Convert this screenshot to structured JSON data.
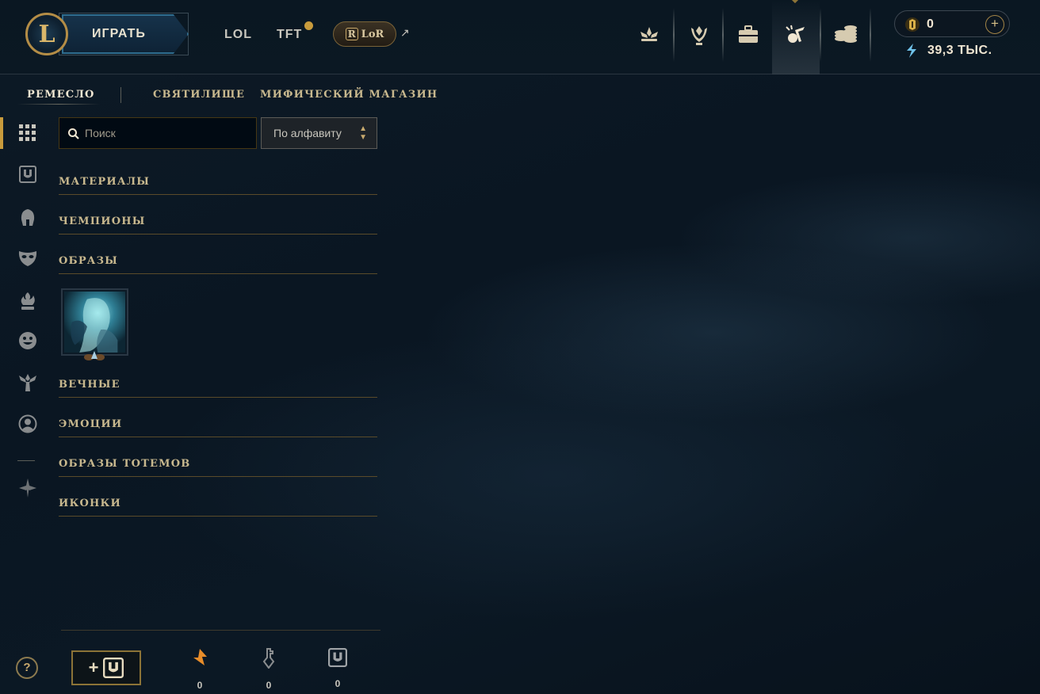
{
  "header": {
    "play_label": "ИГРАТЬ",
    "logo_letter": "L",
    "nav": [
      {
        "label": "LOL"
      },
      {
        "label": "TFT"
      }
    ],
    "lor_label": "LoR",
    "lor_letter": "R",
    "external_arrow": "↗",
    "nav_icons": [
      "challenges-icon",
      "ranked-icon",
      "collection-icon",
      "loot-icon",
      "store-icon"
    ],
    "active_icon": "loot-icon"
  },
  "currency": {
    "rp_value": "0",
    "plus": "+",
    "blue_essence_value": "39,3 ТЫС."
  },
  "subnav": {
    "items": [
      {
        "label": "РЕМЕСЛО",
        "active": true
      },
      {
        "label": "СВЯТИЛИЩЕ",
        "active": false
      },
      {
        "label": "МИФИЧЕСКИЙ МАГАЗИН",
        "active": false
      }
    ]
  },
  "sidebar": {
    "icons": [
      "grid-icon",
      "chest-icon",
      "champion-helmet-icon",
      "mask-icon",
      "eternals-flame-icon",
      "emote-smiley-icon",
      "ward-totem-icon",
      "profile-icon",
      "mythic-icon"
    ],
    "active": "grid-icon"
  },
  "filters": {
    "search_placeholder": "Поиск",
    "sort_value": "По алфавиту"
  },
  "sections": [
    {
      "label": "МАТЕРИАЛЫ"
    },
    {
      "label": "ЧЕМПИОНЫ"
    },
    {
      "label": "ОБРАЗЫ"
    },
    {
      "label": "ВЕЧНЫЕ"
    },
    {
      "label": "ЭМОЦИИ"
    },
    {
      "label": "ОБРАЗЫ ТОТЕМОВ"
    },
    {
      "label": "ИКОНКИ"
    }
  ],
  "footer": {
    "help_label": "?",
    "add_chest_plus": "+",
    "stats": [
      {
        "icon": "orange-essence-icon",
        "count": "0"
      },
      {
        "icon": "key-icon",
        "count": "0"
      },
      {
        "icon": "chest-icon",
        "count": "0"
      }
    ]
  },
  "colors": {
    "gold": "#c89b3c",
    "gold_light": "#c8aa6e",
    "text_light": "#f0e6d2",
    "background": "#0a1622",
    "play_blue": "#2f6d8f",
    "blue_essence": "#6fc1e8",
    "orange_essence": "#e88d2a"
  }
}
